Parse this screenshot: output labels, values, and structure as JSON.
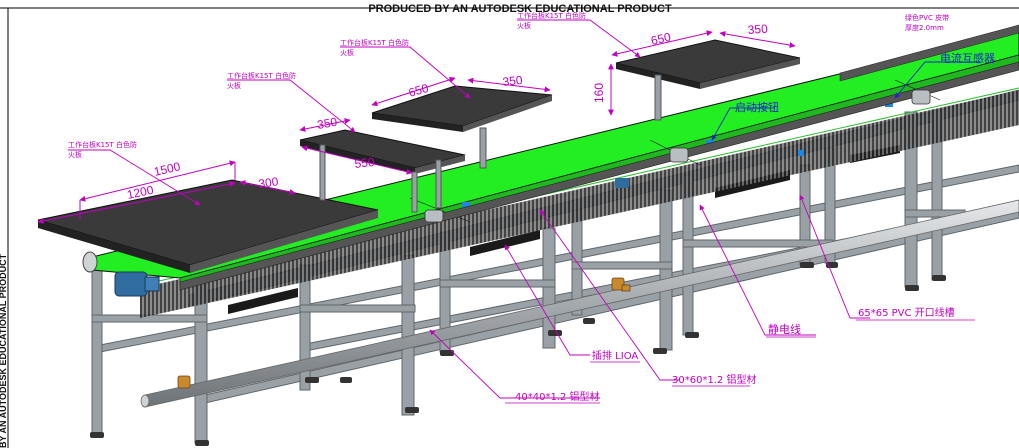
{
  "watermark": {
    "top": "PRODUCED BY AN AUTODESK EDUCATIONAL PRODUCT",
    "side": "BY AN AUTODESK EDUCATIONAL PRODUCT"
  },
  "dimensions": {
    "d1500": "1500",
    "d1200": "1200",
    "d300": "300",
    "d350a": "350",
    "d550": "550",
    "d650a": "650",
    "d350b": "350",
    "d650b": "650",
    "d350c": "350",
    "d160": "160"
  },
  "labels": {
    "ws1_line1": "工作台板K15T 白色防",
    "ws1_line2": "火板",
    "ws2_line1": "工作台板K15T 白色防",
    "ws2_line2": "火板",
    "ws3_line1": "工作台板K15T 白色防",
    "ws3_line2": "火板",
    "ws4_line1": "工作台板K15T 白色防",
    "ws4_line2": "火板",
    "pvc_line1": "绿色PVC 皮带",
    "pvc_line2": "厚度2.0mm",
    "current_transformer": "电流互感器",
    "start_button": "启动按钮",
    "static_wire": "静电线",
    "trunking": "65*65 PVC 开口线槽",
    "socket": "插排 LIOA",
    "profile_30x60": "30*60*1.2 铝型材",
    "profile_40x40": "40*40*1.2 铝型材"
  },
  "colors": {
    "belt": "#22ee22",
    "frame": "#8f979d",
    "table_top": "#3a3a3a",
    "annotation": "#c000c0",
    "blue_note": "#2222cc"
  }
}
